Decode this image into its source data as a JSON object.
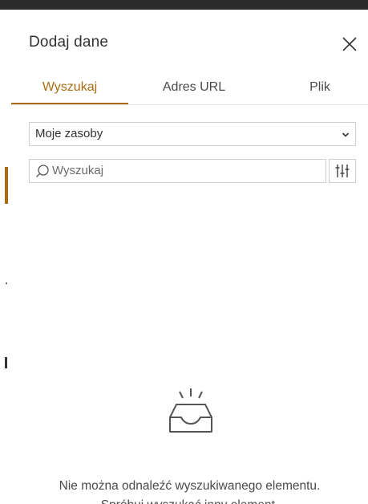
{
  "panel": {
    "title": "Dodaj dane",
    "close_icon": "close-icon"
  },
  "tabs": [
    {
      "label": "Wyszukaj",
      "active": true
    },
    {
      "label": "Adres URL",
      "active": false
    },
    {
      "label": "Plik",
      "active": false
    }
  ],
  "source_select": {
    "value": "Moje zasoby",
    "icon": "chevron-down-icon"
  },
  "search": {
    "placeholder": "Wyszukaj",
    "value": "",
    "icon": "search-icon"
  },
  "filter_button": {
    "icon": "filter-sliders-icon"
  },
  "empty_state": {
    "icon": "empty-inbox-icon",
    "line1": "Nie można odnaleźć wyszukiwanego elementu.",
    "line2": "Spróbuj wyszukać inny element."
  },
  "colors": {
    "accent": "#a86c12",
    "text": "#323232",
    "border": "#cfcfcf"
  }
}
